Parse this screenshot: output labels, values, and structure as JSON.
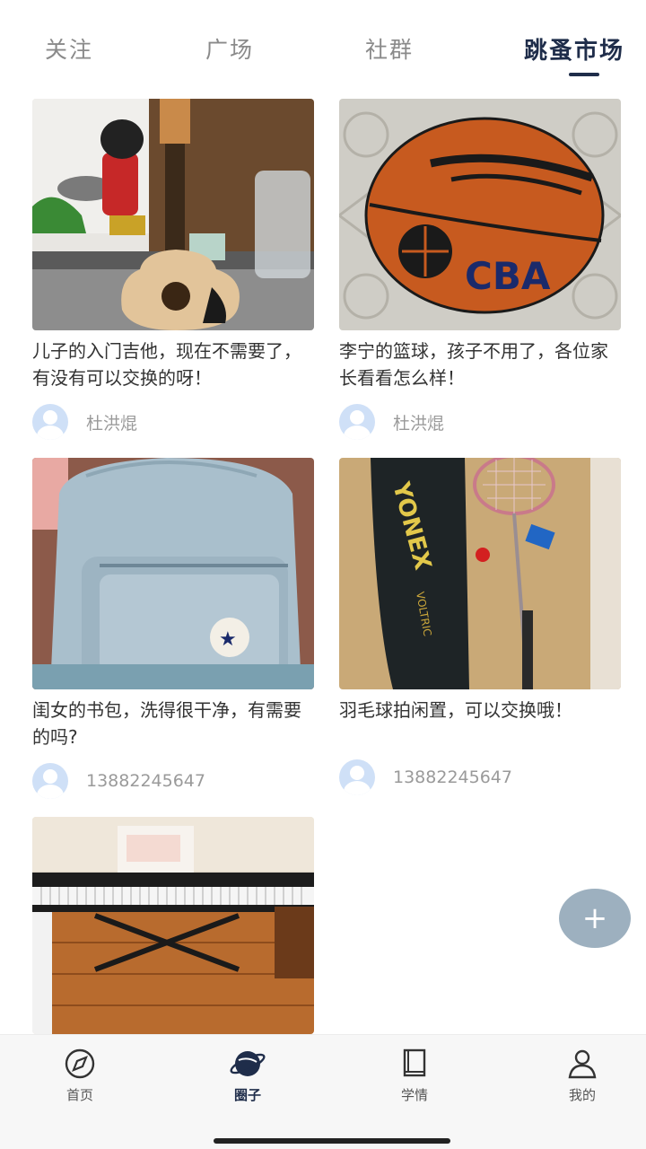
{
  "tabs": [
    {
      "label": "关注"
    },
    {
      "label": "广场"
    },
    {
      "label": "社群"
    },
    {
      "label": "跳蚤市场"
    }
  ],
  "active_tab": "跳蚤市场",
  "posts": [
    {
      "description": "儿子的入门吉他，现在不需要了，有没有可以交换的呀！",
      "author": "杜洪焜",
      "image": "guitar"
    },
    {
      "description": "李宁的篮球，孩子不用了，各位家长看看怎么样！",
      "author": "杜洪焜",
      "image": "basketball"
    },
    {
      "description": "闺女的书包，洗得很干净，有需要的吗?",
      "author": "13882245647",
      "image": "backpack"
    },
    {
      "description": "羽毛球拍闲置，可以交换哦！",
      "author": "13882245647",
      "image": "badminton-racket"
    },
    {
      "description": "",
      "author": "",
      "image": "keyboard-piano"
    }
  ],
  "fab": {
    "icon": "plus-icon",
    "label": "+"
  },
  "bottom_nav": [
    {
      "label": "首页",
      "icon": "compass-icon"
    },
    {
      "label": "圈子",
      "icon": "planet-icon",
      "active": true
    },
    {
      "label": "学情",
      "icon": "book-icon"
    },
    {
      "label": "我的",
      "icon": "user-icon"
    }
  ],
  "colors": {
    "accent": "#1f2d4a",
    "fab": "#9db0bf",
    "avatar": "#cfe0f7"
  }
}
